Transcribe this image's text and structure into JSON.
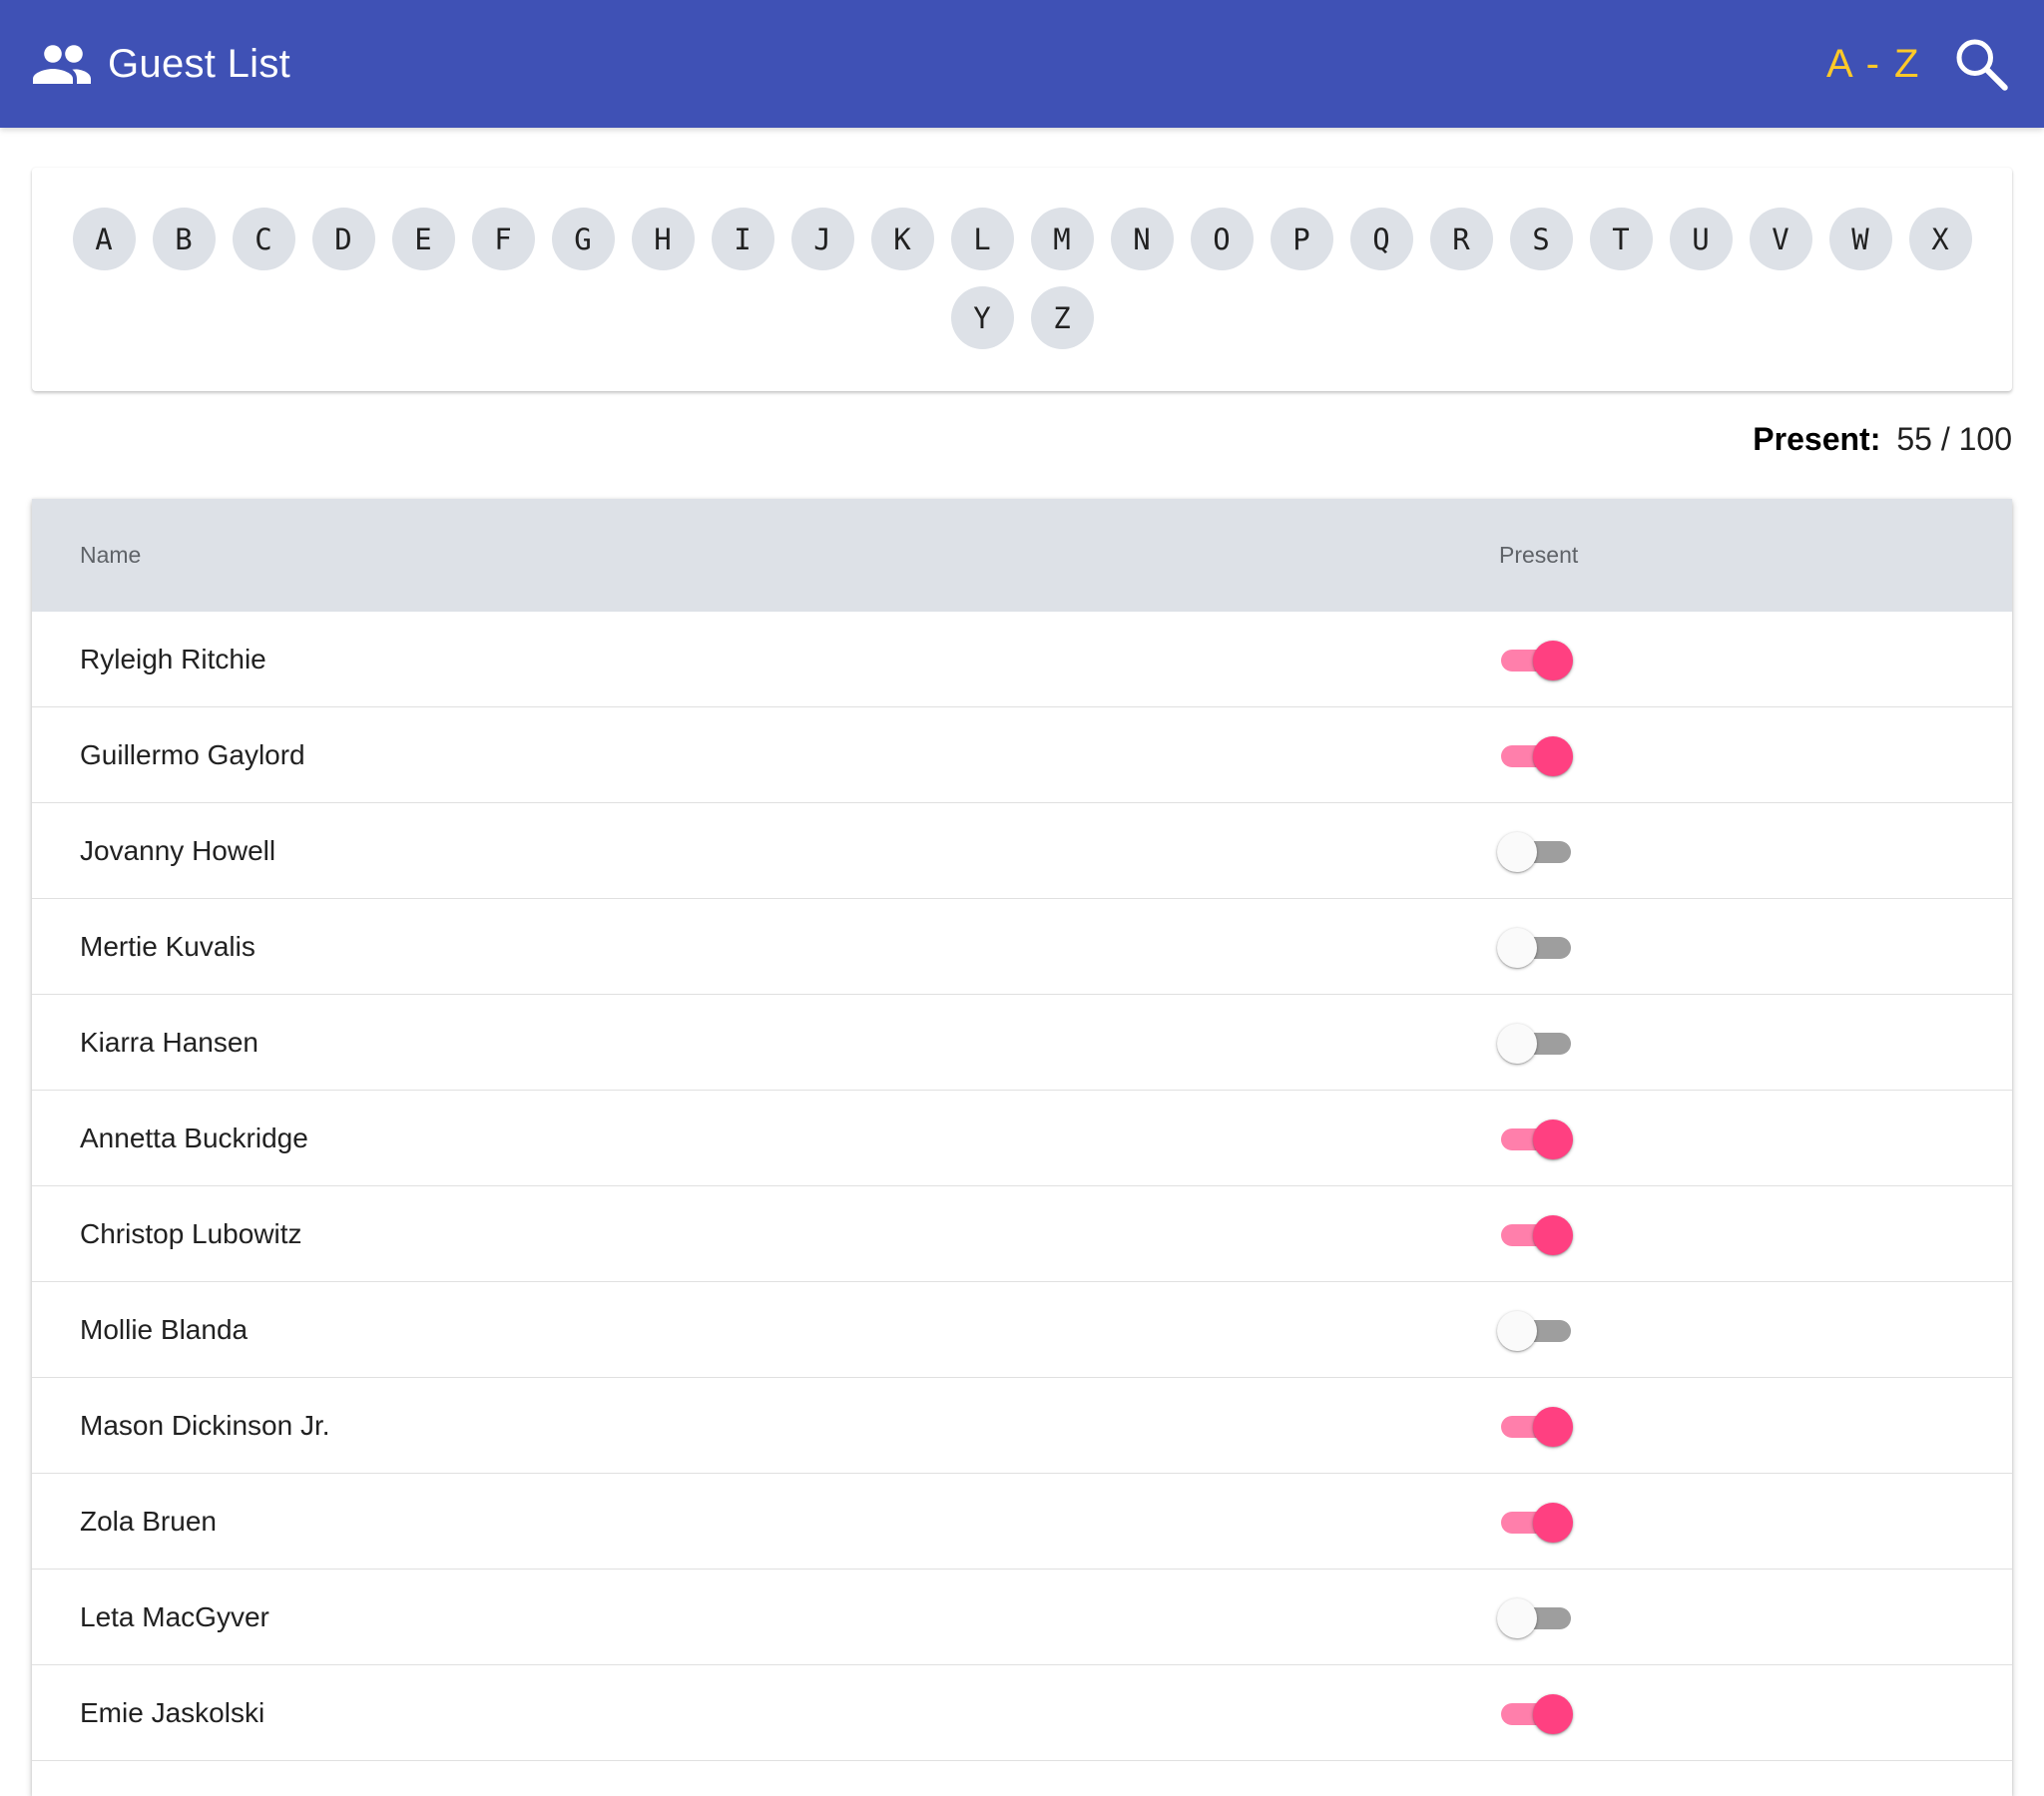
{
  "app": {
    "title": "Guest List",
    "sort_label": "A - Z",
    "icons": {
      "title": "people-icon",
      "search": "search-icon"
    },
    "colors": {
      "primary": "#3f51b5",
      "accent": "#ff4081",
      "sort_text": "#ffc928"
    }
  },
  "alphabet": [
    "A",
    "B",
    "C",
    "D",
    "E",
    "F",
    "G",
    "H",
    "I",
    "J",
    "K",
    "L",
    "M",
    "N",
    "O",
    "P",
    "Q",
    "R",
    "S",
    "T",
    "U",
    "V",
    "W",
    "X",
    "Y",
    "Z"
  ],
  "summary": {
    "label": "Present:",
    "count": "55 / 100"
  },
  "table": {
    "columns": {
      "name": "Name",
      "present": "Present"
    },
    "rows": [
      {
        "name": "Ryleigh Ritchie",
        "present": true
      },
      {
        "name": "Guillermo Gaylord",
        "present": true
      },
      {
        "name": "Jovanny Howell",
        "present": false
      },
      {
        "name": "Mertie Kuvalis",
        "present": false
      },
      {
        "name": "Kiarra Hansen",
        "present": false
      },
      {
        "name": "Annetta Buckridge",
        "present": true
      },
      {
        "name": "Christop Lubowitz",
        "present": true
      },
      {
        "name": "Mollie Blanda",
        "present": false
      },
      {
        "name": "Mason Dickinson Jr.",
        "present": true
      },
      {
        "name": "Zola Bruen",
        "present": true
      },
      {
        "name": "Leta MacGyver",
        "present": false
      },
      {
        "name": "Emie Jaskolski",
        "present": true
      }
    ]
  }
}
